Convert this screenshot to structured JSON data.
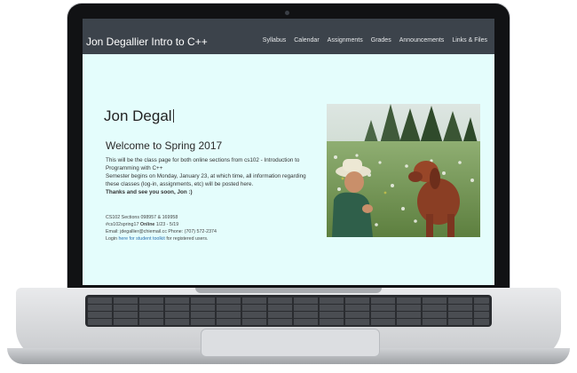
{
  "site": {
    "title": "Jon Degallier Intro to C++"
  },
  "nav": {
    "items": [
      "Syllabus",
      "Calendar",
      "Assignments",
      "Grades",
      "Announcements",
      "Links & Files"
    ]
  },
  "main": {
    "heading": "Jon Degal",
    "welcome": "Welcome to Spring 2017",
    "intro_line1": "This will be the class page for both online sections from cs102 - Introduction to Programming with C++",
    "intro_line2": "Semester begins on Monday, January 23, at which time, all information regarding these classes (log-in, assignments, etc) will be posted here.",
    "intro_line3": "Thanks and see you soon, Jon :)",
    "sections": "CS102 Sections 098957 & 169958",
    "hashtag": "#cs102spring17",
    "online_label": "Online",
    "online_dates": "1/23 - 5/19",
    "email_line": "Email: jdegallier@chiemail.cc  Phone: (707) 572-2374",
    "login_prefix": "Login ",
    "login_link": "here for student toolkit",
    "login_suffix": " for registered users."
  },
  "photo": {
    "subject": "man-with-dog-in-meadow"
  },
  "colors": {
    "navbar": "#3c434b",
    "page_background": "#e4fdfc"
  }
}
